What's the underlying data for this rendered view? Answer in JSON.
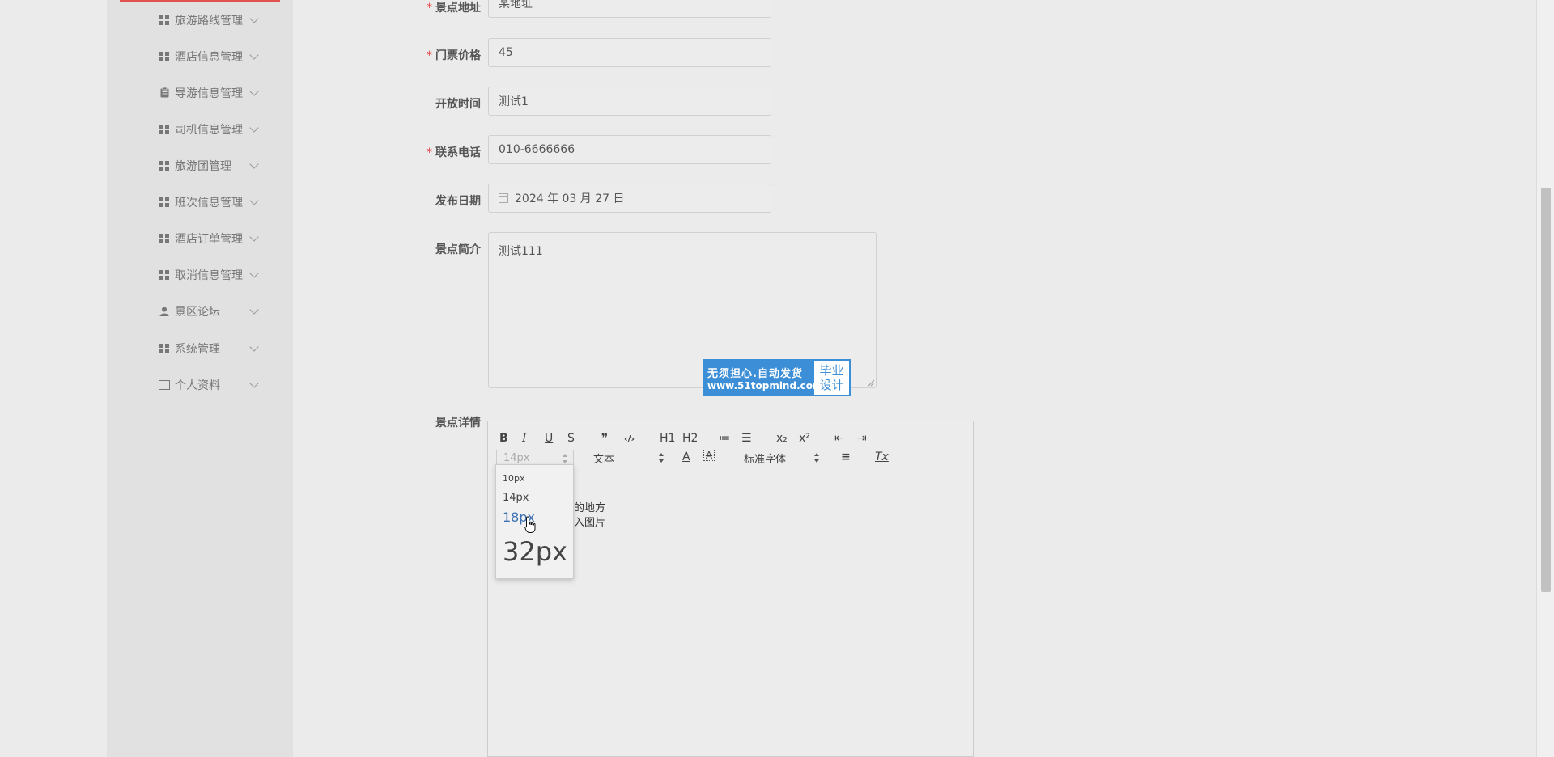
{
  "sidebar": {
    "items": [
      {
        "label": "旅游路线管理",
        "icon": "grid-icon"
      },
      {
        "label": "酒店信息管理",
        "icon": "grid-icon"
      },
      {
        "label": "导游信息管理",
        "icon": "clipboard-icon"
      },
      {
        "label": "司机信息管理",
        "icon": "grid-icon"
      },
      {
        "label": "旅游团管理",
        "icon": "grid-icon"
      },
      {
        "label": "班次信息管理",
        "icon": "grid-icon"
      },
      {
        "label": "酒店订单管理",
        "icon": "grid-icon"
      },
      {
        "label": "取消信息管理",
        "icon": "grid-icon"
      },
      {
        "label": "景区论坛",
        "icon": "user-icon"
      },
      {
        "label": "系统管理",
        "icon": "grid-icon"
      },
      {
        "label": "个人资料",
        "icon": "card-icon"
      }
    ]
  },
  "form": {
    "address": {
      "label": "景点地址",
      "required": "*",
      "value": "某地址"
    },
    "price": {
      "label": "门票价格",
      "required": "*",
      "value": "45"
    },
    "open_time": {
      "label": "开放时间",
      "value": "测试1"
    },
    "phone": {
      "label": "联系电话",
      "required": "*",
      "value": "010-6666666"
    },
    "publish_date": {
      "label": "发布日期",
      "value": "2024 年 03 月 27 日"
    },
    "intro": {
      "label": "景点简介",
      "value": "测试111"
    },
    "detail": {
      "label": "景点详情"
    }
  },
  "watermark": {
    "line1": "无须担心.自动发货",
    "line2": "www.51topmind.com",
    "right1": "毕业",
    "right2": "设计"
  },
  "editor": {
    "toolbar": {
      "bold": "B",
      "italic": "I",
      "underline": "U",
      "strike": "S",
      "blockquote": "❞",
      "code": "‹/›",
      "h1": "H1",
      "h2": "H2",
      "ordered_list": "≔",
      "bullet_list": "☰",
      "subscript": "x₂",
      "superscript": "x²",
      "outdent": "⇤",
      "indent": "⇥",
      "size_value": "14px",
      "header_value": "文本",
      "font_color": "A",
      "bg_color": "A",
      "font_value": "标准字体",
      "align": "≡",
      "clean": "Tx"
    },
    "content_line1": "的地方",
    "content_line2": "入图片",
    "size_options": [
      "10px",
      "14px",
      "18px",
      "32px"
    ]
  },
  "colors": {
    "accent_active": "#e0524d",
    "required": "#e4393c",
    "dropdown_highlight": "#3b6fb3",
    "watermark_blue": "#3c8ed6"
  }
}
